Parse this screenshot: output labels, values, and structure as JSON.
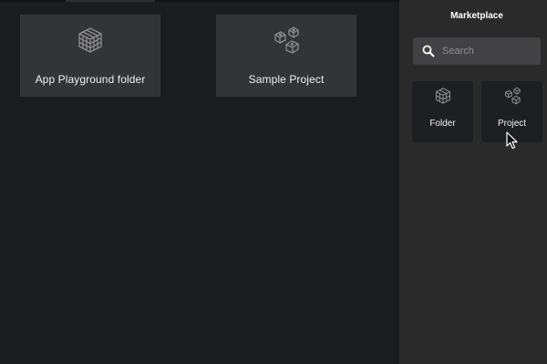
{
  "workspace": {
    "tiles": [
      {
        "label": "App Playground folder",
        "icon": "cube-icon"
      },
      {
        "label": "Sample Project",
        "icon": "dice-icon"
      }
    ]
  },
  "marketplace": {
    "title": "Marketplace",
    "search": {
      "placeholder": "Search",
      "value": ""
    },
    "items": [
      {
        "label": "Folder",
        "icon": "cube-icon"
      },
      {
        "label": "Project",
        "icon": "dice-icon"
      }
    ]
  },
  "colors": {
    "background": "#1b1c1f",
    "tile": "#333436",
    "panel": "#2a2a2b",
    "search_field": "#424244",
    "panel_item": "#1e1f22"
  }
}
